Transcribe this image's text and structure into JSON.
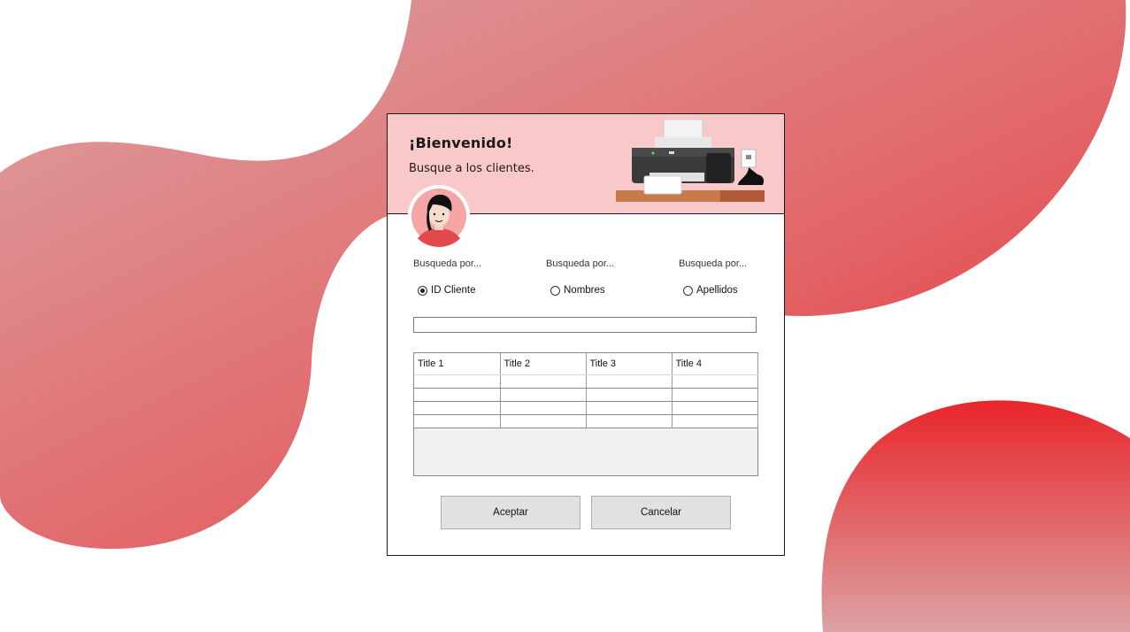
{
  "header": {
    "welcome": "¡Bienvenido!",
    "subtitle": "Busque a los clientes."
  },
  "search": {
    "options": [
      {
        "caption": "Busqueda por...",
        "label": "ID Cliente",
        "checked": true
      },
      {
        "caption": "Busqueda por...",
        "label": "Nombres",
        "checked": false
      },
      {
        "caption": "Busqueda por...",
        "label": "Apellidos",
        "checked": false
      }
    ],
    "value": ""
  },
  "grid": {
    "columns": [
      "Title 1",
      "Title 2",
      "Title 3",
      "Title 4"
    ],
    "rows": [
      [
        "",
        "",
        "",
        ""
      ],
      [
        "",
        "",
        "",
        ""
      ],
      [
        "",
        "",
        "",
        ""
      ],
      [
        "",
        "",
        "",
        ""
      ]
    ]
  },
  "buttons": {
    "accept": "Aceptar",
    "cancel": "Cancelar"
  },
  "colors": {
    "header_bg": "#f9c8c8",
    "accent_red": "#e8262a",
    "blob_light": "#dca0a2"
  },
  "icons": {
    "printer": "printer-illustration",
    "avatar": "user-avatar"
  }
}
